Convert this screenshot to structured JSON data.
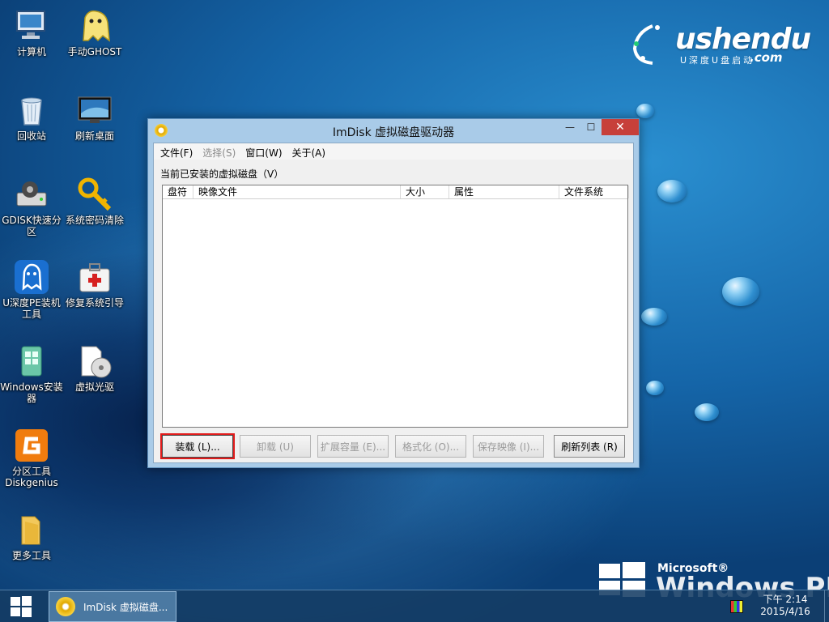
{
  "desktop": {
    "icons": [
      {
        "label": "计算机"
      },
      {
        "label": "手动GHOST"
      },
      {
        "label": "回收站"
      },
      {
        "label": "刷新桌面"
      },
      {
        "label": "GDISK快速分区"
      },
      {
        "label": "系统密码清除"
      },
      {
        "label": "U深度PE装机工具"
      },
      {
        "label": "修复系统引导"
      },
      {
        "label": "Windows安装器"
      },
      {
        "label": "虚拟光驱"
      },
      {
        "label": "分区工具Diskgenius"
      },
      {
        "label": "更多工具"
      }
    ]
  },
  "brand": {
    "logo_word": "ushendu",
    "logo_sub": "U深度U盘启动",
    "logo_dotcom": ".com",
    "ms": "Microsoft®",
    "pe": "Windows PE"
  },
  "window": {
    "title": "ImDisk 虚拟磁盘驱动器",
    "minimize": "—",
    "maximize": "☐",
    "close": "✕",
    "menu": [
      {
        "label": "文件(F)",
        "enabled": true
      },
      {
        "label": "选择(S)",
        "enabled": false
      },
      {
        "label": "窗口(W)",
        "enabled": true
      },
      {
        "label": "关于(A)",
        "enabled": true
      }
    ],
    "section_label": "当前已安装的虚拟磁盘（V）",
    "columns": [
      "盘符",
      "映像文件",
      "大小",
      "属性",
      "文件系统"
    ],
    "buttons": [
      {
        "label": "装载 (L)...",
        "enabled": true,
        "highlighted": true
      },
      {
        "label": "卸载 (U)",
        "enabled": false
      },
      {
        "label": "扩展容量 (E)...",
        "enabled": false
      },
      {
        "label": "格式化 (O)...",
        "enabled": false
      },
      {
        "label": "保存映像 (I)...",
        "enabled": false
      },
      {
        "label": "刷新列表 (R)",
        "enabled": true
      }
    ]
  },
  "taskbar": {
    "active_task": "ImDisk 虚拟磁盘...",
    "clock_time": "下午 2:14",
    "clock_date": "2015/4/16"
  },
  "colors": {
    "accent": "#a9cbe8",
    "close": "#c7403a",
    "highlight": "#e01b1b"
  }
}
